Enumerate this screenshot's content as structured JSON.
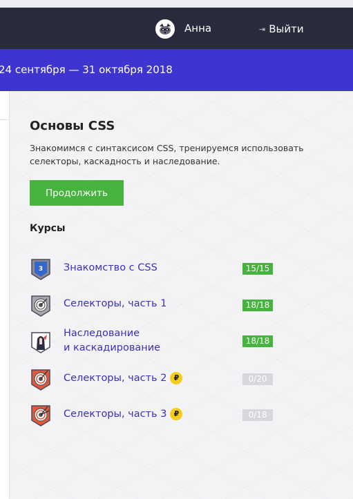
{
  "header": {
    "username": "Анна",
    "logout_label": "Выйти"
  },
  "banner": {
    "dates": "24 сентября — 31 октября 2018"
  },
  "module": {
    "title": "Основы CSS",
    "description": "Знакомимся с синтаксисом CSS, тренируемся использовать селекторы, каскадность и наследование.",
    "continue_label": "Продолжить",
    "courses_heading": "Курсы"
  },
  "courses": [
    {
      "name_line1": "Знакомство с CSS",
      "name_line2": "",
      "progress": "15/15",
      "completed": true,
      "paid": false,
      "icon": "css-badge-icon"
    },
    {
      "name_line1": "Селекторы, часть 1",
      "name_line2": "",
      "progress": "18/18",
      "completed": true,
      "paid": false,
      "icon": "target-badge-icon"
    },
    {
      "name_line1": "Наследование",
      "name_line2": "и каскадирование",
      "progress": "18/18",
      "completed": true,
      "paid": false,
      "icon": "knight-badge-icon"
    },
    {
      "name_line1": "Селекторы, часть 2",
      "name_line2": "",
      "progress": "0/20",
      "completed": false,
      "paid": true,
      "icon": "target-badge-icon"
    },
    {
      "name_line1": "Селекторы, часть 3",
      "name_line2": "",
      "progress": "0/18",
      "completed": false,
      "paid": true,
      "icon": "target-badge-icon"
    }
  ],
  "coin_symbol": "₽",
  "colors": {
    "header_bg": "#2a2a3d",
    "banner_bg": "#3e35d0",
    "accent_green": "#45b33e",
    "link": "#3b2fc0",
    "coin": "#f5cc18"
  }
}
